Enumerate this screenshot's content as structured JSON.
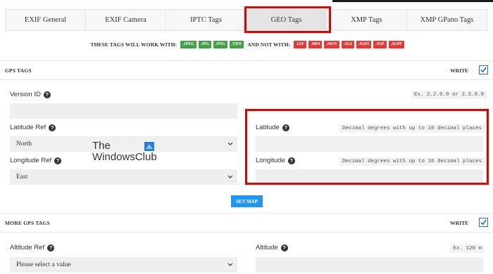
{
  "tabs": [
    {
      "label": "EXIF General"
    },
    {
      "label": "EXIF Camera"
    },
    {
      "label": "IPTC Tags"
    },
    {
      "label": "GEO Tags"
    },
    {
      "label": "XMP Tags"
    },
    {
      "label": "XMP GPano Tags"
    }
  ],
  "active_tab": "GEO Tags",
  "compat": {
    "works_text": "THESE TAGS WILL WORK WITH:",
    "works_formats": [
      ".JPEG",
      ".JPG",
      ".PNG",
      ".TIFF"
    ],
    "not_text": "AND NOT WITH:",
    "not_formats": [
      ".GIF",
      ".MP4",
      ".MOV",
      ".3G2",
      ".3GP2",
      ".3GP",
      ".3GPP"
    ]
  },
  "gps": {
    "title": "GPS TAGS",
    "write_label": "WRITE",
    "write_checked": true,
    "version_id": {
      "label": "Version ID",
      "hint": "Ex. 2.2.0.0 or 2.3.0.0",
      "value": ""
    },
    "latitude_ref": {
      "label": "Latitude Ref",
      "value": "North"
    },
    "longitude_ref": {
      "label": "Longitude Ref",
      "value": "East"
    },
    "latitude": {
      "label": "Latitude",
      "hint": "Decimal degrees with up to 10 decimal places",
      "value": ""
    },
    "longitude": {
      "label": "Longitude",
      "hint": "Decimal degrees with up to 10 decimal places",
      "value": ""
    },
    "set_map_label": "SET MAP"
  },
  "more_gps": {
    "title": "MORE GPS TAGS",
    "write_label": "WRITE",
    "write_checked": true,
    "altitude_ref": {
      "label": "Altitude Ref",
      "value": "Please select a value"
    },
    "altitude": {
      "label": "Altitude",
      "hint": "Ex. 120 m",
      "value": ""
    }
  },
  "watermark": {
    "line1": "The",
    "line2": "WindowsClub"
  },
  "colors": {
    "highlight": "#e00000",
    "ok_badge": "#43a047",
    "bad_badge": "#e53935",
    "button": "#2196f3",
    "checkbox": "#2c6fb0"
  }
}
